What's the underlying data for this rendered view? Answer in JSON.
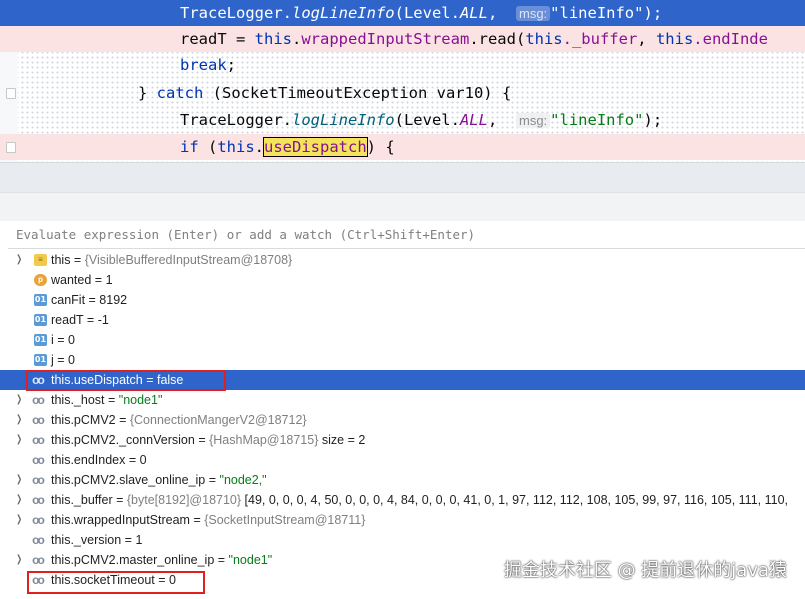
{
  "code": {
    "lines": [
      {
        "indent": "TraceLogger.",
        "method": "logLineInfo",
        "open": "(Level.",
        "const": "ALL",
        "sep": ", ",
        "hint": "msg:",
        "str": "\"lineInfo\"",
        "close": ");"
      },
      {
        "a": "readT = ",
        "kw": "this",
        "dot": ".",
        "field": "wrappedInputStream",
        "rest": ".read(",
        "kw2": "this",
        "field2": "._buffer",
        "sep": ", ",
        "kw3": "this",
        "tail": ".endInde"
      },
      {
        "kw": "break",
        "tail": ";"
      },
      {
        "brace": "} ",
        "kw": "catch",
        "rest": " (SocketTimeoutException var10) {"
      },
      {
        "indent": "TraceLogger.",
        "method": "logLineInfo",
        "open": "(Level.",
        "const": "ALL",
        "sep": ", ",
        "hint": "msg:",
        "str": "\"lineInfo\"",
        "close": ");"
      },
      {
        "kw": "if",
        "open": " (",
        "kw2": "this",
        "dot": ".",
        "field": "useDispatch",
        "close": ") {"
      }
    ]
  },
  "eval": {
    "placeholder": "Evaluate expression (Enter) or add a watch (Ctrl+Shift+Enter)"
  },
  "variables": [
    {
      "name": "this",
      "eq": " = ",
      "value": "{VisibleBufferedInputStream@18708}",
      "icon": "list-icon",
      "expand": true
    },
    {
      "name": "wanted",
      "eq": " = ",
      "value": "1",
      "icon": "parameter-icon"
    },
    {
      "name": "canFit",
      "eq": " = ",
      "value": "8192",
      "icon": "field-icon"
    },
    {
      "name": "readT",
      "eq": " = ",
      "value": "-1",
      "icon": "field-icon"
    },
    {
      "name": "i",
      "eq": " = ",
      "value": "0",
      "icon": "field-icon"
    },
    {
      "name": "j",
      "eq": " = ",
      "value": "0",
      "icon": "field-icon"
    },
    {
      "name": "this.useDispatch",
      "eq": " = ",
      "value": "false",
      "icon": "watch-icon",
      "selected": true
    },
    {
      "name": "this._host",
      "eq": " = ",
      "value": "\"node1\"",
      "icon": "watch-icon",
      "expand": true,
      "str": true
    },
    {
      "name": "this.pCMV2",
      "eq": " = ",
      "value": "{ConnectionMangerV2@18712}",
      "icon": "watch-icon",
      "expand": true
    },
    {
      "name": "this.pCMV2._connVersion",
      "eq": " = ",
      "value": "{HashMap@18715}",
      "extra": "  size = 2",
      "icon": "watch-icon",
      "expand": true
    },
    {
      "name": "this.endIndex",
      "eq": " = ",
      "value": "0",
      "icon": "watch-icon"
    },
    {
      "name": "this.pCMV2.slave_online_ip",
      "eq": " = ",
      "value": "\"node2,\"",
      "icon": "watch-icon",
      "expand": true,
      "str": true
    },
    {
      "name": "this._buffer",
      "eq": " = ",
      "value": "{byte[8192]@18710}",
      "extra": " [49, 0, 0, 0, 4, 50, 0, 0, 0, 4, 84, 0, 0, 0, 41, 0, 1, 97, 112, 112, 108, 105, 99, 97, 116, 105, 111, 110,",
      "icon": "watch-icon",
      "expand": true
    },
    {
      "name": "this.wrappedInputStream",
      "eq": " = ",
      "value": "{SocketInputStream@18711}",
      "icon": "watch-icon",
      "expand": true
    },
    {
      "name": "this._version",
      "eq": " = ",
      "value": "1",
      "icon": "watch-icon"
    },
    {
      "name": "this.pCMV2.master_online_ip",
      "eq": " = ",
      "value": "\"node1\"",
      "icon": "watch-icon",
      "expand": true,
      "str": true
    },
    {
      "name": "this.socketTimeout",
      "eq": " = ",
      "value": "0",
      "icon": "watch-icon"
    }
  ],
  "watermark": "掘金技术社区 @ 提前退休的java猿"
}
